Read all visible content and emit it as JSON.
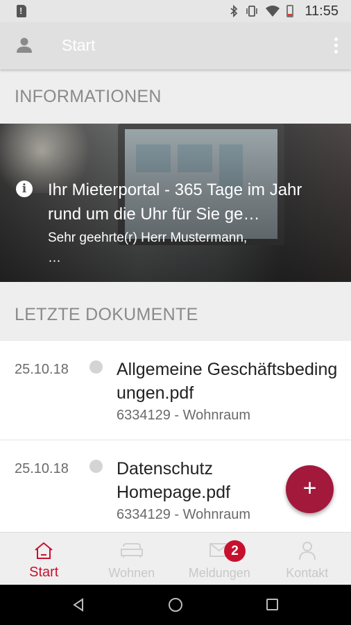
{
  "status_bar": {
    "time": "11:55",
    "icons": [
      "sd-card-alert-icon",
      "bluetooth-icon",
      "vibrate-icon",
      "wifi-icon",
      "battery-low-icon"
    ]
  },
  "app_bar": {
    "title": "Start",
    "left_icon": "person-icon",
    "right_icon": "more-vert-icon"
  },
  "sections": {
    "info_header": "INFORMATIONEN",
    "docs_header": "LETZTE DOKUMENTE"
  },
  "hero": {
    "icon": "info-icon",
    "headline": "Ihr Mieterportal - 365 Tage im Jahr rund um die Uhr für Sie ge…",
    "subtext": "Sehr geehrte(r) Herr Mustermann,",
    "ellipsis": "…"
  },
  "documents": [
    {
      "date": "25.10.18",
      "name": "Allgemeine Geschäftsbedingungen.pdf",
      "meta": "6334129 - Wohnraum"
    },
    {
      "date": "25.10.18",
      "name": "Datenschutz Homepage.pdf",
      "meta": "6334129 - Wohnraum"
    }
  ],
  "fab": {
    "label": "+",
    "icon": "add-icon",
    "color": "#a3193b"
  },
  "bottom_nav": {
    "items": [
      {
        "label": "Start",
        "icon": "home-icon",
        "active": true
      },
      {
        "label": "Wohnen",
        "icon": "sofa-icon",
        "active": false
      },
      {
        "label": "Meldungen",
        "icon": "mail-icon",
        "active": false
      },
      {
        "label": "Kontakt",
        "icon": "person-outline-icon",
        "active": false
      }
    ],
    "badge": "2",
    "active_color": "#c8102e"
  },
  "system_nav": {
    "icons": [
      "back-icon",
      "home-circle-icon",
      "recents-icon"
    ]
  }
}
